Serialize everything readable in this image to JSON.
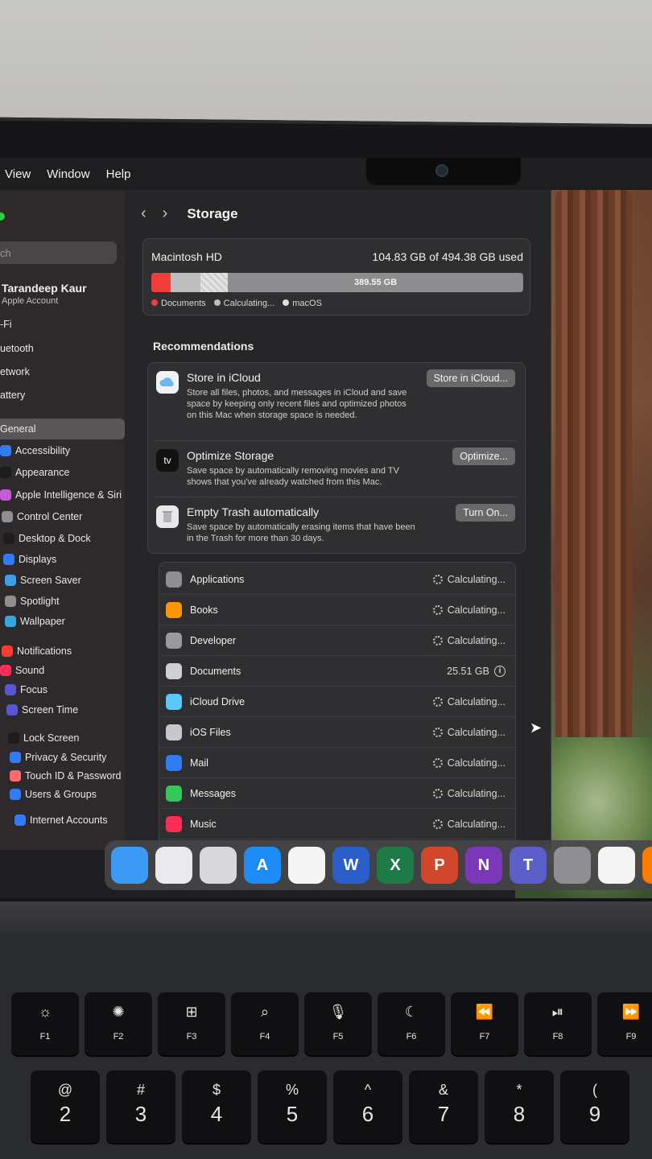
{
  "menubar": [
    "View",
    "Window",
    "Help"
  ],
  "sidebar": {
    "search_placeholder": "ch",
    "user": {
      "name": "Tarandeep Kaur",
      "subtitle": "Apple Account"
    },
    "items": [
      {
        "label": "-Fi",
        "color": "#2f7cf6"
      },
      {
        "label": "uetooth",
        "color": "#2f7cf6"
      },
      {
        "label": "etwork",
        "color": "#2f7cf6"
      },
      {
        "label": "attery",
        "color": "#39c46a"
      },
      {
        "label": "General",
        "color": "#8e8e93",
        "active": true
      },
      {
        "label": "Accessibility",
        "color": "#2f7cf6"
      },
      {
        "label": "Appearance",
        "color": "#1c1c1e"
      },
      {
        "label": "Apple Intelligence & Siri",
        "color": "#c45bd6"
      },
      {
        "label": "Control Center",
        "color": "#8e8e93"
      },
      {
        "label": "Desktop & Dock",
        "color": "#1c1c1e"
      },
      {
        "label": "Displays",
        "color": "#2f7cf6"
      },
      {
        "label": "Screen Saver",
        "color": "#3aa0e8"
      },
      {
        "label": "Spotlight",
        "color": "#8e8e93"
      },
      {
        "label": "Wallpaper",
        "color": "#34aadc"
      },
      {
        "label": "Notifications",
        "color": "#ff3b30"
      },
      {
        "label": "Sound",
        "color": "#ff2d55"
      },
      {
        "label": "Focus",
        "color": "#5856d6"
      },
      {
        "label": "Screen Time",
        "color": "#5856d6"
      },
      {
        "label": "Lock Screen",
        "color": "#1c1c1e"
      },
      {
        "label": "Privacy & Security",
        "color": "#2f7cf6"
      },
      {
        "label": "Touch ID & Password",
        "color": "#ff6b6b"
      },
      {
        "label": "Users & Groups",
        "color": "#2f7cf6"
      },
      {
        "label": "Internet Accounts",
        "color": "#2f7cf6"
      }
    ]
  },
  "main": {
    "title": "Storage",
    "disk": {
      "name": "Macintosh HD",
      "used_text": "104.83 GB of 494.38 GB used",
      "free_text": "389.55 GB",
      "segments": [
        {
          "name": "Documents",
          "fraction": 0.052,
          "color": "#f23b3b"
        },
        {
          "name": "Calculating...",
          "fraction": 0.08,
          "color": "#bdbdbd"
        },
        {
          "name": "macOS",
          "fraction": 0.074,
          "color": "#e0dfdf"
        }
      ]
    },
    "recommendations_heading": "Recommendations",
    "recommendations": [
      {
        "title": "Store in iCloud",
        "description": "Store all files, photos, and messages in iCloud and save space by keeping only recent files and optimized photos on this Mac when storage space is needed.",
        "button": "Store in iCloud...",
        "icon": "icloud-icon"
      },
      {
        "title": "Optimize Storage",
        "description": "Save space by automatically removing movies and TV shows that you've already watched from this Mac.",
        "button": "Optimize...",
        "icon": "apple-tv-icon",
        "icon_text": "tv"
      },
      {
        "title": "Empty Trash automatically",
        "description": "Save space by automatically erasing items that have been in the Trash for more than 30 days.",
        "button": "Turn On...",
        "icon": "trash-icon"
      }
    ],
    "categories": [
      {
        "name": "Applications",
        "value": "Calculating...",
        "color": "#8e8e93",
        "calculating": true
      },
      {
        "name": "Books",
        "value": "Calculating...",
        "color": "#ff9500",
        "calculating": true
      },
      {
        "name": "Developer",
        "value": "Calculating...",
        "color": "#9a9a9e",
        "calculating": true
      },
      {
        "name": "Documents",
        "value": "25.51 GB",
        "color": "#d0d0d4",
        "calculating": false
      },
      {
        "name": "iCloud Drive",
        "value": "Calculating...",
        "color": "#5ac8fa",
        "calculating": true
      },
      {
        "name": "iOS Files",
        "value": "Calculating...",
        "color": "#c7c7cc",
        "calculating": true
      },
      {
        "name": "Mail",
        "value": "Calculating...",
        "color": "#2f7cf6",
        "calculating": true
      },
      {
        "name": "Messages",
        "value": "Calculating...",
        "color": "#34c759",
        "calculating": true
      },
      {
        "name": "Music",
        "value": "Calculating...",
        "color": "#ff2d55",
        "calculating": true
      }
    ]
  },
  "dock": [
    {
      "name": "finder-icon",
      "color": "#3c9af5",
      "text": ""
    },
    {
      "name": "launchpad-icon",
      "color": "#e9e9ee",
      "text": ""
    },
    {
      "name": "calculator-icon",
      "color": "#d8d8dc",
      "text": ""
    },
    {
      "name": "app-store-icon",
      "color": "#1e8cf7",
      "text": "A"
    },
    {
      "name": "photos-icon",
      "color": "#f4f4f4",
      "text": ""
    },
    {
      "name": "word-icon",
      "color": "#2a5ec9",
      "text": "W"
    },
    {
      "name": "excel-icon",
      "color": "#1e7b45",
      "text": "X"
    },
    {
      "name": "powerpoint-icon",
      "color": "#d2472c",
      "text": "P"
    },
    {
      "name": "onenote-icon",
      "color": "#7a38b8",
      "text": "N"
    },
    {
      "name": "teams-icon",
      "color": "#5b5fc7",
      "text": "T"
    },
    {
      "name": "system-settings-icon",
      "color": "#8e8e93",
      "text": ""
    },
    {
      "name": "chrome-icon",
      "color": "#f4f4f4",
      "text": ""
    },
    {
      "name": "firefox-icon",
      "color": "#ff7b00",
      "text": ""
    }
  ],
  "keyboard": {
    "fkeys": [
      {
        "glyph": "☼",
        "label": "F1"
      },
      {
        "glyph": "✺",
        "label": "F2"
      },
      {
        "glyph": "⊞",
        "label": "F3"
      },
      {
        "glyph": "⌕",
        "label": "F4"
      },
      {
        "glyph": "🎙",
        "label": "F5"
      },
      {
        "glyph": "☾",
        "label": "F6"
      },
      {
        "glyph": "⏪",
        "label": "F7"
      },
      {
        "glyph": "⏯",
        "label": "F8"
      },
      {
        "glyph": "⏩",
        "label": "F9"
      }
    ],
    "numkeys": [
      {
        "top": "@",
        "bottom": "2"
      },
      {
        "top": "#",
        "bottom": "3"
      },
      {
        "top": "$",
        "bottom": "4"
      },
      {
        "top": "%",
        "bottom": "5"
      },
      {
        "top": "^",
        "bottom": "6"
      },
      {
        "top": "&",
        "bottom": "7"
      },
      {
        "top": "*",
        "bottom": "8"
      },
      {
        "top": "(",
        "bottom": "9"
      }
    ]
  }
}
